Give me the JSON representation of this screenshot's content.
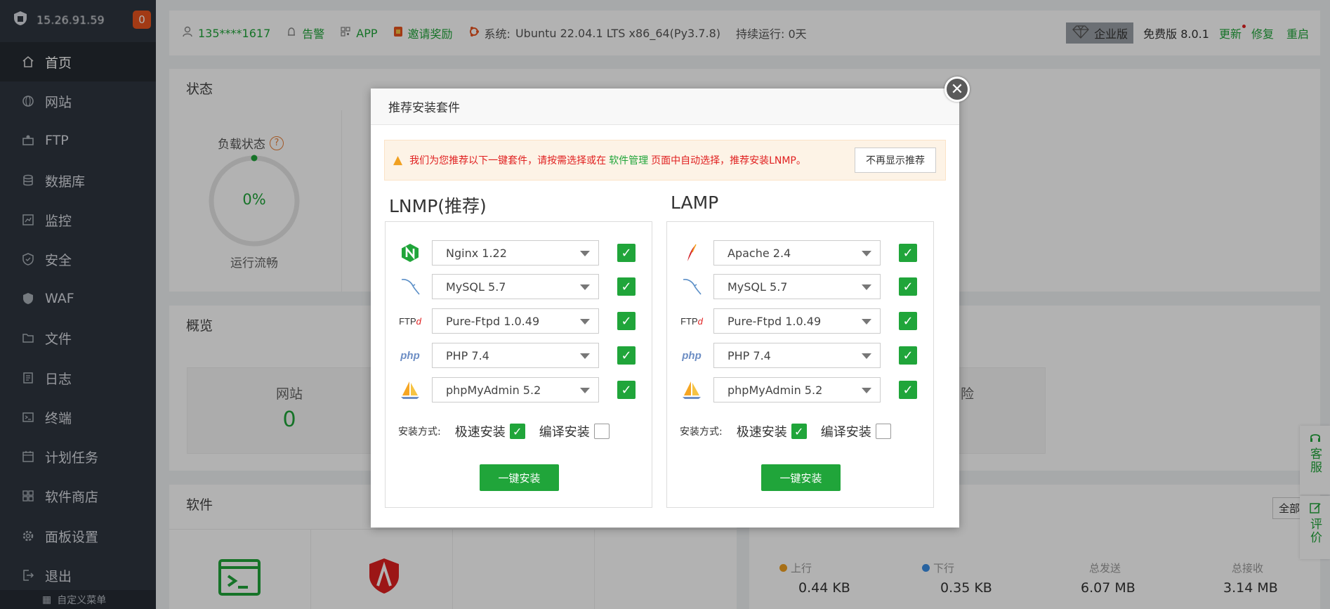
{
  "sidebar": {
    "server_ip": "15.26.91.59",
    "alert_count": "0",
    "items": [
      {
        "label": "首页",
        "icon": "home-icon"
      },
      {
        "label": "网站",
        "icon": "globe-icon"
      },
      {
        "label": "FTP",
        "icon": "ftp-icon"
      },
      {
        "label": "数据库",
        "icon": "database-icon"
      },
      {
        "label": "监控",
        "icon": "monitor-icon"
      },
      {
        "label": "安全",
        "icon": "shield-icon"
      },
      {
        "label": "WAF",
        "icon": "waf-icon"
      },
      {
        "label": "文件",
        "icon": "folder-icon"
      },
      {
        "label": "日志",
        "icon": "log-icon"
      },
      {
        "label": "终端",
        "icon": "terminal-icon"
      },
      {
        "label": "计划任务",
        "icon": "calendar-icon"
      },
      {
        "label": "软件商店",
        "icon": "grid-icon"
      },
      {
        "label": "面板设置",
        "icon": "gear-icon"
      },
      {
        "label": "退出",
        "icon": "logout-icon"
      }
    ],
    "custom_menu": "自定义菜单"
  },
  "topbar": {
    "user": "135****1617",
    "alarm": "告警",
    "app": "APP",
    "invite": "邀请奖励",
    "system_label": "系统:",
    "system_value": "Ubuntu 22.04.1 LTS x86_64(Py3.7.8)",
    "uptime": "持续运行: 0天",
    "enterprise": "企业版",
    "free_label": "免费版",
    "version": "8.0.1",
    "update": "更新",
    "repair": "修复",
    "restart": "重启"
  },
  "status_panel": {
    "title": "状态",
    "load_label": "负载状态",
    "load_value": "0%",
    "load_text": "运行流畅"
  },
  "overview_panel": {
    "title": "概览",
    "site_label": "网站",
    "site_value": "0",
    "risk_label": "险"
  },
  "software_panel": {
    "title": "软件"
  },
  "traffic_panel": {
    "all_label": "全部",
    "up_label": "上行",
    "down_label": "下行",
    "sent_label": "总发送",
    "recv_label": "总接收",
    "up_value": "0.44 KB",
    "down_value": "0.35 KB",
    "sent_value": "6.07 MB",
    "recv_value": "3.14 MB",
    "up_color": "#f0a020",
    "down_color": "#3a8ee6"
  },
  "float": {
    "service": "客服",
    "feedback": "评价"
  },
  "modal": {
    "title": "推荐安装套件",
    "alert_pre": "我们为您推荐以下一键套件，请按需选择或在",
    "alert_link": "软件管理",
    "alert_post": "页面中自动选择，推荐安装LNMP。",
    "dismiss": "不再显示推荐",
    "method_label": "安装方式:",
    "fast_install": "极速安装",
    "compile_install": "编译安装",
    "install_button": "一键安装",
    "lnmp": {
      "title": "LNMP(推荐)",
      "rows": [
        {
          "icon": "nginx-icon",
          "value": "Nginx 1.22"
        },
        {
          "icon": "mysql-icon",
          "value": "MySQL 5.7"
        },
        {
          "icon": "ftp-icon",
          "value": "Pure-Ftpd 1.0.49"
        },
        {
          "icon": "php-icon",
          "value": "PHP 7.4"
        },
        {
          "icon": "phpmyadmin-icon",
          "value": "phpMyAdmin 5.2"
        }
      ]
    },
    "lamp": {
      "title": "LAMP",
      "rows": [
        {
          "icon": "apache-icon",
          "value": "Apache 2.4"
        },
        {
          "icon": "mysql-icon",
          "value": "MySQL 5.7"
        },
        {
          "icon": "ftp-icon",
          "value": "Pure-Ftpd 1.0.49"
        },
        {
          "icon": "php-icon",
          "value": "PHP 7.4"
        },
        {
          "icon": "phpmyadmin-icon",
          "value": "phpMyAdmin 5.2"
        }
      ]
    }
  },
  "colors": {
    "accent": "#20a53a",
    "sidebar_bg": "#2f3640",
    "badge": "#e8541f",
    "alert_text": "#e02020"
  }
}
